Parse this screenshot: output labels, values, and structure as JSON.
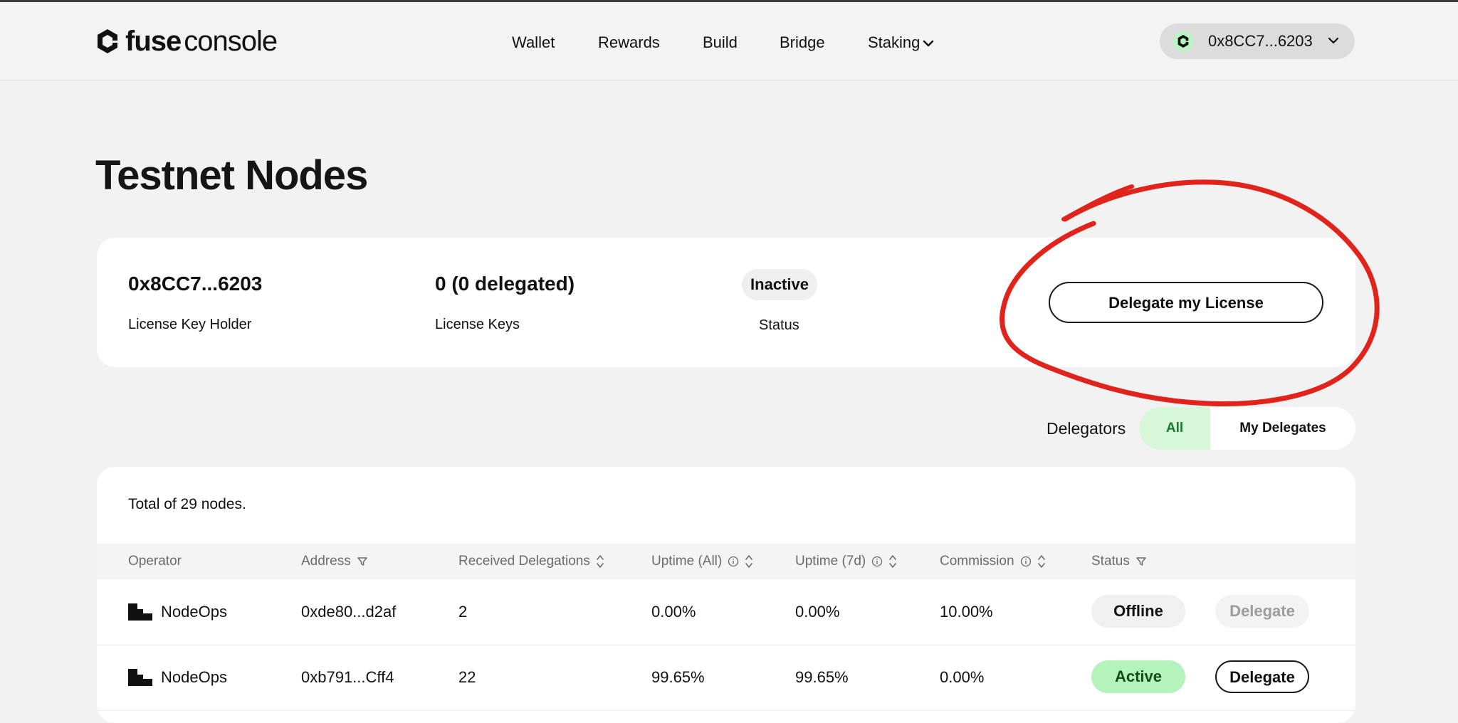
{
  "header": {
    "logo_bold": "fuse",
    "logo_light": "console",
    "nav": [
      "Wallet",
      "Rewards",
      "Build",
      "Bridge",
      "Staking"
    ],
    "wallet_address": "0x8CC7...6203"
  },
  "page": {
    "title": "Testnet Nodes"
  },
  "license_card": {
    "holder_value": "0x8CC7...6203",
    "holder_label": "License Key Holder",
    "keys_value": "0 (0 delegated)",
    "keys_label": "License Keys",
    "status_value": "Inactive",
    "status_label": "Status",
    "delegate_button": "Delegate my License",
    "annotation_color": "#e0231b"
  },
  "delegators_filter": {
    "label": "Delegators",
    "options": [
      "All",
      "My Delegates"
    ],
    "selected": "All"
  },
  "table": {
    "total_text": "Total of 29 nodes.",
    "columns": {
      "operator": "Operator",
      "address": "Address",
      "received": "Received Delegations",
      "uptime_all": "Uptime (All)",
      "uptime_7d": "Uptime (7d)",
      "commission": "Commission",
      "status": "Status"
    },
    "rows": [
      {
        "operator": "NodeOps",
        "address": "0xde80...d2af",
        "received": "2",
        "uptime_all": "0.00%",
        "uptime_7d": "0.00%",
        "commission": "10.00%",
        "status": "Offline",
        "action": "Delegate"
      },
      {
        "operator": "NodeOps",
        "address": "0xb791...Cff4",
        "received": "22",
        "uptime_all": "99.65%",
        "uptime_7d": "99.65%",
        "commission": "0.00%",
        "status": "Active",
        "action": "Delegate"
      }
    ]
  },
  "colors": {
    "accent_green": "#b5f3bd",
    "annotation_red": "#e0231b"
  }
}
